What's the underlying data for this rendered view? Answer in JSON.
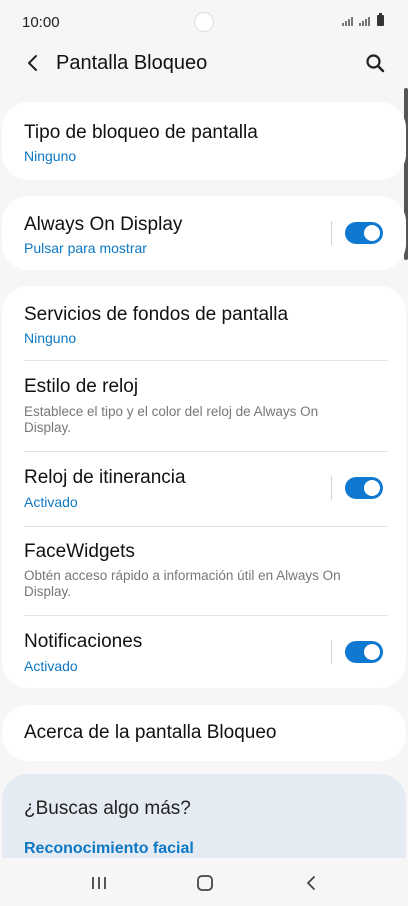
{
  "status_bar": {
    "time": "10:00"
  },
  "header": {
    "title": "Pantalla Bloqueo"
  },
  "sections": {
    "lock_type": {
      "title": "Tipo de bloqueo de pantalla",
      "subtitle": "Ninguno"
    },
    "always_on": {
      "title": "Always On Display",
      "subtitle": "Pulsar para mostrar",
      "toggle": true
    },
    "wallpaper_services": {
      "title": "Servicios de fondos de pantalla",
      "subtitle": "Ninguno"
    },
    "clock_style": {
      "title": "Estilo de reloj",
      "description": "Establece el tipo y el color del reloj de Always On Display."
    },
    "roaming_clock": {
      "title": "Reloj de itinerancia",
      "subtitle": "Activado",
      "toggle": true
    },
    "facewidgets": {
      "title": "FaceWidgets",
      "description": "Obtén acceso rápido a información útil en Always On Display."
    },
    "notifications": {
      "title": "Notificaciones",
      "subtitle": "Activado",
      "toggle": true
    },
    "about": {
      "title": "Acerca de la pantalla Bloqueo"
    }
  },
  "suggestions": {
    "title": "¿Buscas algo más?",
    "link": "Reconocimiento facial"
  },
  "colors": {
    "accent": "#0f79d1",
    "link": "#0e78c4",
    "background": "#f6f6f6",
    "card": "#ffffff",
    "suggest_bg": "#e5ebf2"
  },
  "icons": {
    "back": "chevron-left-icon",
    "search": "search-icon",
    "nav_recent": "recent-apps-icon",
    "nav_home": "home-icon",
    "nav_back": "nav-back-icon"
  }
}
